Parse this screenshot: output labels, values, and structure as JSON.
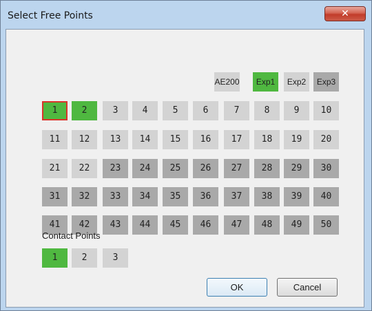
{
  "window": {
    "title": "Select Free Points",
    "close_symbol": "✕"
  },
  "expansion_headers": [
    {
      "label": "AE200",
      "state": "light"
    },
    {
      "label": "Exp1",
      "state": "green"
    },
    {
      "label": "Exp2",
      "state": "light"
    },
    {
      "label": "Exp3",
      "state": "dark"
    }
  ],
  "free_points": [
    [
      {
        "label": "1",
        "state": "green",
        "selected": true
      },
      {
        "label": "2",
        "state": "green"
      },
      {
        "label": "3",
        "state": "light"
      },
      {
        "label": "4",
        "state": "light"
      },
      {
        "label": "5",
        "state": "light"
      },
      {
        "label": "6",
        "state": "light"
      },
      {
        "label": "7",
        "state": "light"
      },
      {
        "label": "8",
        "state": "light"
      },
      {
        "label": "9",
        "state": "light"
      },
      {
        "label": "10",
        "state": "light"
      }
    ],
    [
      {
        "label": "11",
        "state": "light"
      },
      {
        "label": "12",
        "state": "light"
      },
      {
        "label": "13",
        "state": "light"
      },
      {
        "label": "14",
        "state": "light"
      },
      {
        "label": "15",
        "state": "light"
      },
      {
        "label": "16",
        "state": "light"
      },
      {
        "label": "17",
        "state": "light"
      },
      {
        "label": "18",
        "state": "light"
      },
      {
        "label": "19",
        "state": "light"
      },
      {
        "label": "20",
        "state": "light"
      }
    ],
    [
      {
        "label": "21",
        "state": "light"
      },
      {
        "label": "22",
        "state": "light"
      },
      {
        "label": "23",
        "state": "dark"
      },
      {
        "label": "24",
        "state": "dark"
      },
      {
        "label": "25",
        "state": "dark"
      },
      {
        "label": "26",
        "state": "dark"
      },
      {
        "label": "27",
        "state": "dark"
      },
      {
        "label": "28",
        "state": "dark"
      },
      {
        "label": "29",
        "state": "dark"
      },
      {
        "label": "30",
        "state": "dark"
      }
    ],
    [
      {
        "label": "31",
        "state": "dark"
      },
      {
        "label": "32",
        "state": "dark"
      },
      {
        "label": "33",
        "state": "dark"
      },
      {
        "label": "34",
        "state": "dark"
      },
      {
        "label": "35",
        "state": "dark"
      },
      {
        "label": "36",
        "state": "dark"
      },
      {
        "label": "37",
        "state": "dark"
      },
      {
        "label": "38",
        "state": "dark"
      },
      {
        "label": "39",
        "state": "dark"
      },
      {
        "label": "40",
        "state": "dark"
      }
    ],
    [
      {
        "label": "41",
        "state": "dark"
      },
      {
        "label": "42",
        "state": "dark"
      },
      {
        "label": "43",
        "state": "dark"
      },
      {
        "label": "44",
        "state": "dark"
      },
      {
        "label": "45",
        "state": "dark"
      },
      {
        "label": "46",
        "state": "dark"
      },
      {
        "label": "47",
        "state": "dark"
      },
      {
        "label": "48",
        "state": "dark"
      },
      {
        "label": "49",
        "state": "dark"
      },
      {
        "label": "50",
        "state": "dark"
      }
    ]
  ],
  "contact_points": {
    "label": "Contact Points",
    "items": [
      {
        "label": "1",
        "state": "green"
      },
      {
        "label": "2",
        "state": "light"
      },
      {
        "label": "3",
        "state": "light"
      }
    ]
  },
  "buttons": {
    "ok": "OK",
    "cancel": "Cancel"
  },
  "colors": {
    "green": "#4fb840",
    "light": "#d3d3d3",
    "dark": "#a9a9a9",
    "selected_border": "#d9342a",
    "title_bar": "#bcd5ee"
  }
}
